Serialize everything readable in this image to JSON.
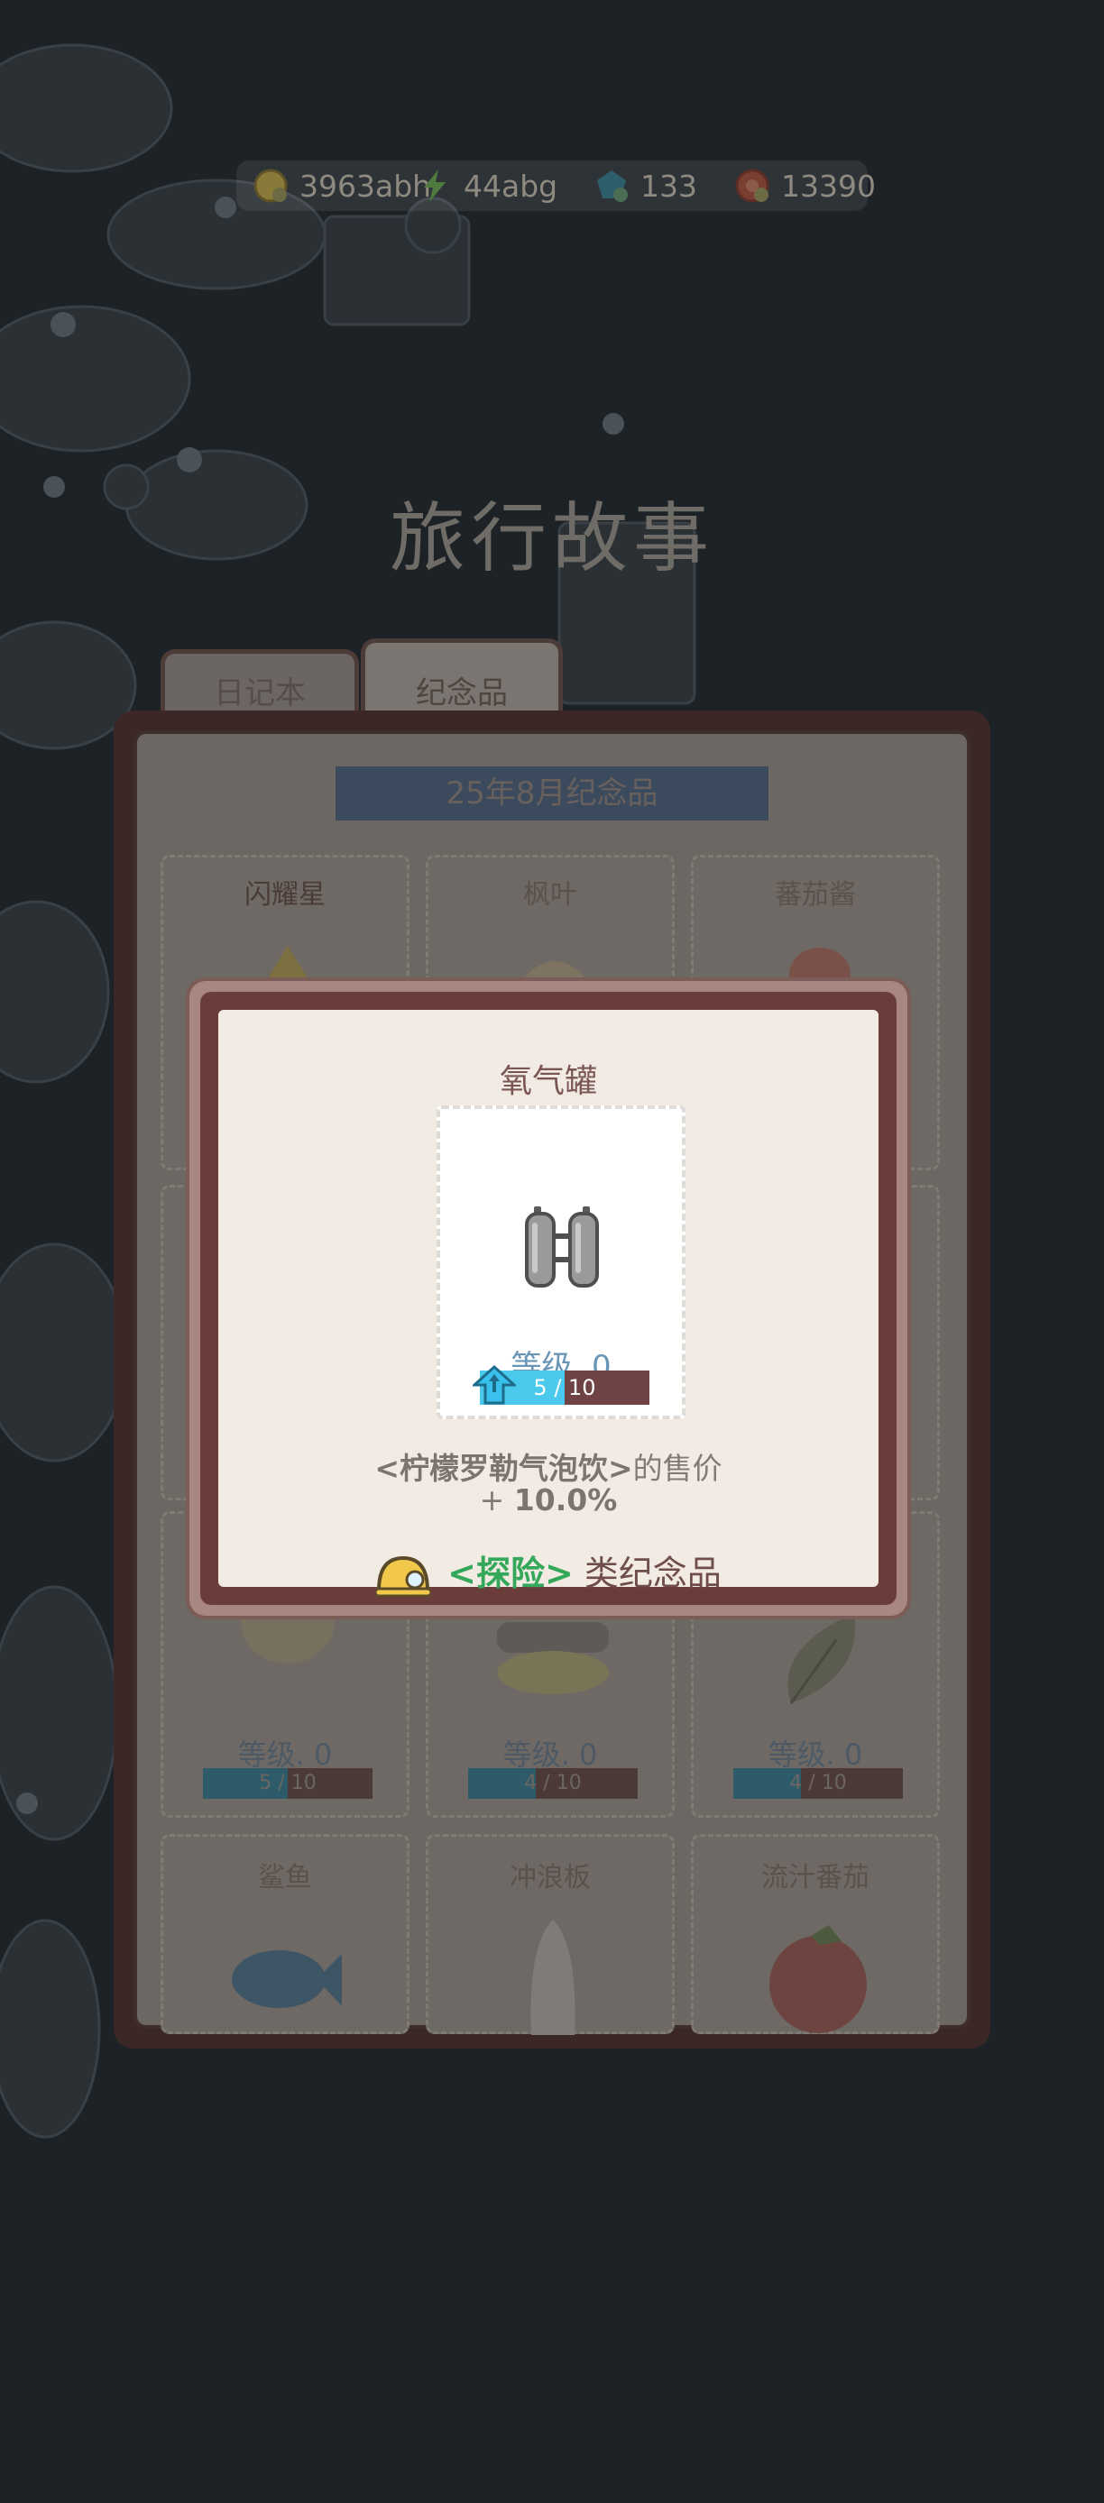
{
  "resources": [
    {
      "icon": "gold-coin-icon",
      "value": "3963abh"
    },
    {
      "icon": "lightning-icon",
      "value": "44abg"
    },
    {
      "icon": "blue-gem-icon",
      "value": "133"
    },
    {
      "icon": "red-token-icon",
      "value": "13390"
    }
  ],
  "page_title": "旅行故事",
  "tabs": [
    {
      "label": "日记本",
      "active": false
    },
    {
      "label": "纪念品",
      "active": true
    }
  ],
  "month_banner": "25年8月纪念品",
  "grid": {
    "row1": [
      "闪耀星",
      "枫叶",
      "蕃茄酱"
    ],
    "row3": [
      {
        "level": "等级. 0",
        "progress": "5 / 10",
        "fraction": 0.5
      },
      {
        "level": "等级. 0",
        "progress": "4 / 10",
        "fraction": 0.4
      },
      {
        "level": "等级. 0",
        "progress": "4 / 10",
        "fraction": 0.4
      }
    ],
    "row4": [
      "鲨鱼",
      "冲浪板",
      "流汁番茄"
    ]
  },
  "dialog": {
    "title": "氧气罐",
    "item_icon": "oxygen-tank-icon",
    "level": "等级. 0",
    "progress": "5 / 10",
    "progress_fraction": 0.5,
    "desc_product": "<柠檬罗勒气泡饮>",
    "desc_suffix": "的售价",
    "bonus_sign": "+ ",
    "bonus_value": "10.0%",
    "category_icon": "miner-helmet-icon",
    "category": "<探险>",
    "category_suffix": " 类纪念品"
  },
  "colors": {
    "category_green": "#34a85a",
    "level_blue": "#6996b6",
    "progress_cyan": "#4ac9ec"
  }
}
